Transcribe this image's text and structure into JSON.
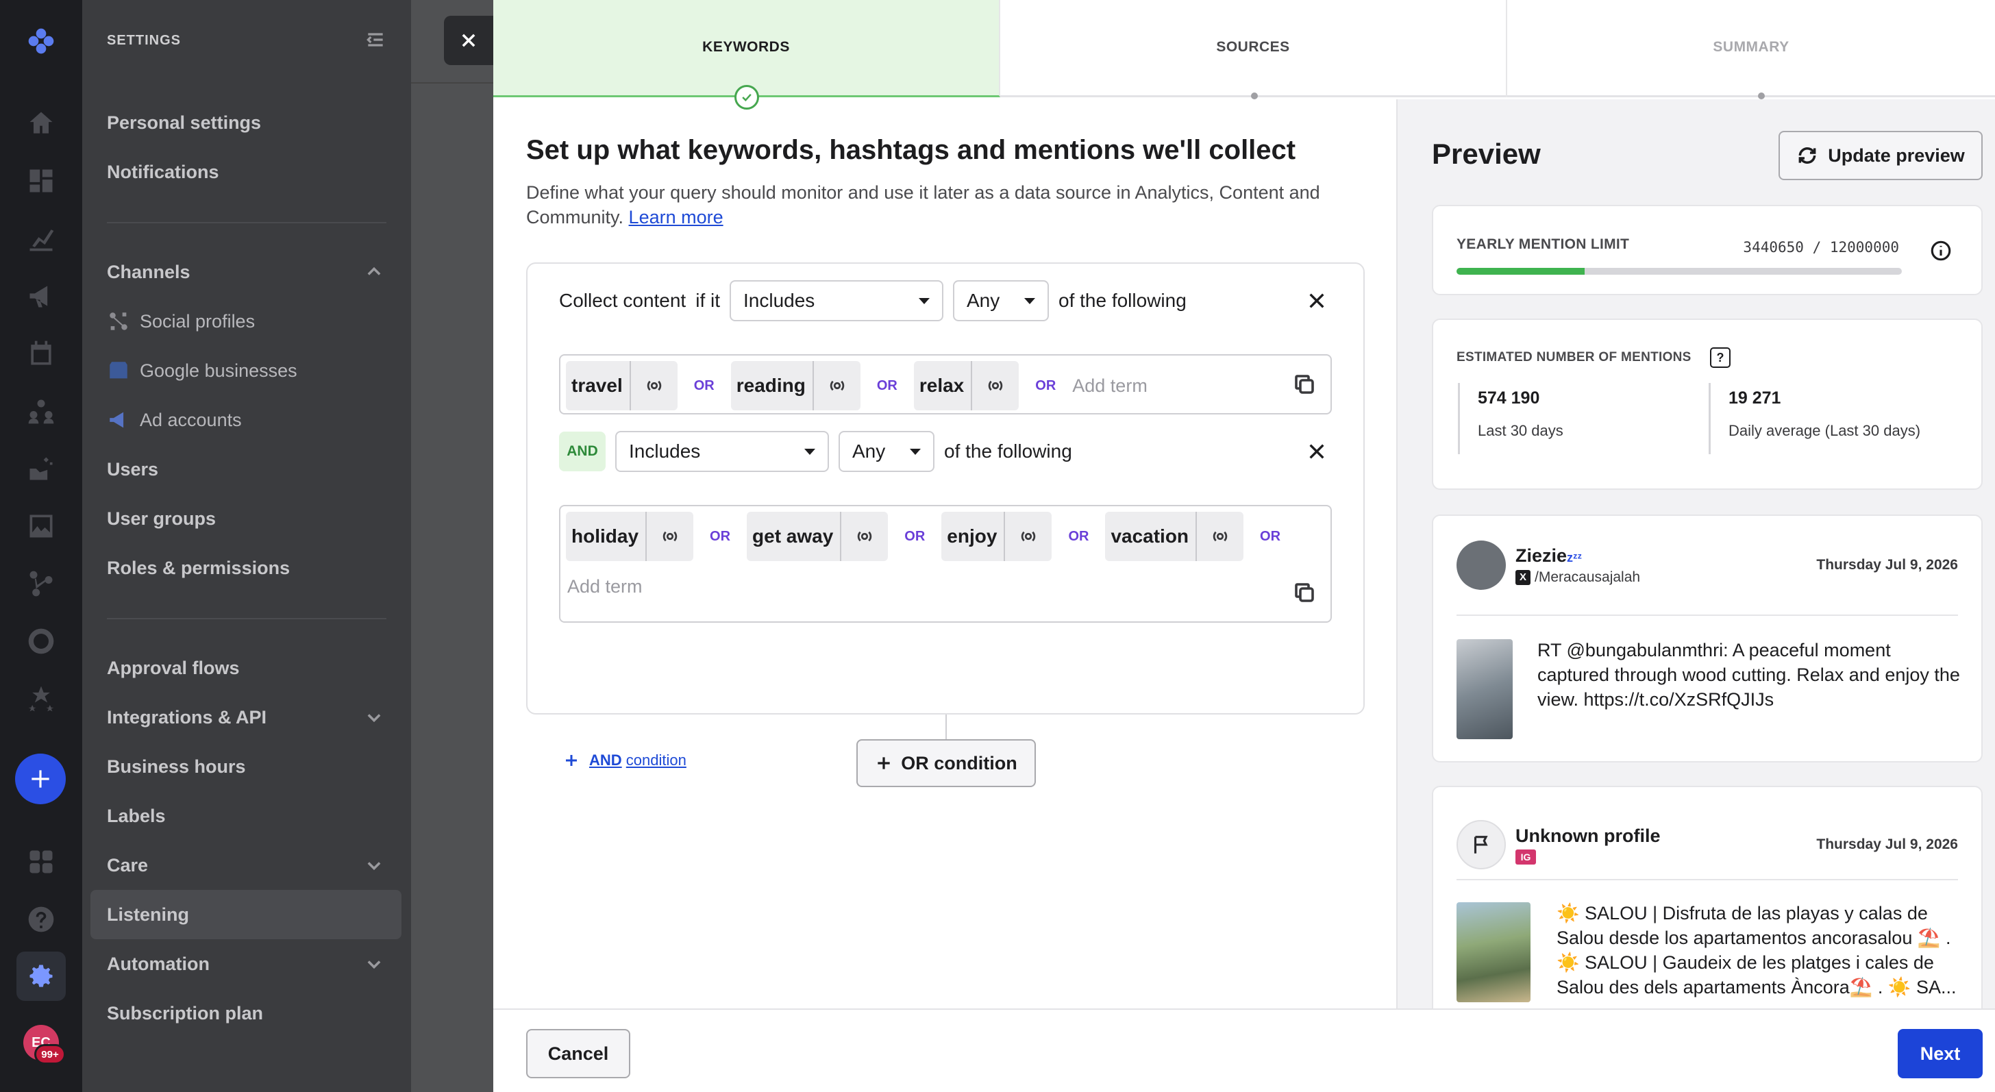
{
  "rail": {
    "avatar_initials": "EC",
    "notifications_badge": "99+"
  },
  "sidebar": {
    "title": "SETTINGS",
    "items": {
      "personal": "Personal settings",
      "notifications": "Notifications",
      "channels": "Channels",
      "social_profiles": "Social profiles",
      "google_businesses": "Google businesses",
      "ad_accounts": "Ad accounts",
      "users": "Users",
      "user_groups": "User groups",
      "roles": "Roles & permissions",
      "approval_flows": "Approval flows",
      "integrations": "Integrations & API",
      "business_hours": "Business hours",
      "labels": "Labels",
      "care": "Care",
      "listening": "Listening",
      "automation": "Automation",
      "subscription": "Subscription plan"
    }
  },
  "steps": {
    "keywords": "KEYWORDS",
    "sources": "SOURCES",
    "summary": "SUMMARY"
  },
  "main": {
    "heading": "Set up what keywords, hashtags and mentions we'll collect",
    "description": "Define what your query should monitor and use it later as a data source in Analytics, Content and Community.",
    "learn_more": "Learn more",
    "condition1": {
      "prefix": "Collect content",
      "if_it": "if it",
      "mode": "Includes",
      "quant": "Any",
      "suffix": "of the following",
      "terms": [
        "travel",
        "reading",
        "relax"
      ],
      "or_label": "OR",
      "add_term": "Add term"
    },
    "condition2": {
      "and_label": "AND",
      "mode": "Includes",
      "quant": "Any",
      "suffix": "of the following",
      "terms": [
        "holiday",
        "get away",
        "enjoy",
        "vacation"
      ],
      "or_label": "OR",
      "add_term": "Add term"
    },
    "and_condition_bold": "AND",
    "and_condition_rest": "condition",
    "or_condition": "OR condition"
  },
  "preview": {
    "title": "Preview",
    "update_button": "Update preview",
    "yearly_limit_label": "YEARLY MENTION LIMIT",
    "yearly_limit_value": "3440650 / 12000000",
    "yearly_limit_progress": 0.287,
    "estimated_label": "ESTIMATED NUMBER OF MENTIONS",
    "stat1_value": "574 190",
    "stat1_label": "Last 30 days",
    "stat2_value": "19 271",
    "stat2_label": "Daily average (Last 30 days)",
    "posts": [
      {
        "name": "Ziezie",
        "name_suffix": "zᶻᶻ",
        "network_badge": "X",
        "handle": "/Meracausajalah",
        "date": "Thursday Jul 9, 2026",
        "text": "RT @bungabulanmthri: A peaceful moment captured through wood cutting. Relax and enjoy the view. https://t.co/XzSRfQJIJs"
      },
      {
        "name": "Unknown profile",
        "network_badge": "IG",
        "date": "Thursday Jul 9, 2026",
        "text": "☀️ SALOU | Disfruta de las playas y calas de Salou desde los apartamentos ancorasalou ⛱️ . ☀️ SALOU | Gaudeix de les platges i cales de Salou des dels apartaments Àncora⛱️ . ☀️ SA..."
      }
    ]
  },
  "footer": {
    "cancel": "Cancel",
    "next": "Next"
  }
}
